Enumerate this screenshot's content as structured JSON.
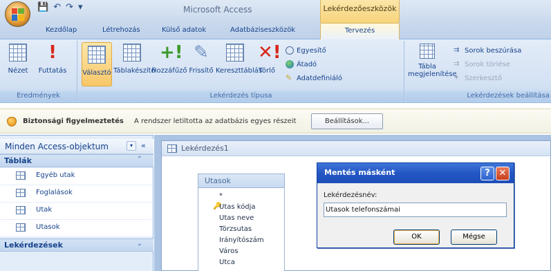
{
  "window": {
    "app_title": "Microsoft Access",
    "context_tab_title": "Lekérdezőeszközök",
    "qat": {
      "save_glyph": "💾",
      "undo_glyph": "↶",
      "redo_glyph": "↷",
      "customize_glyph": "▾"
    }
  },
  "tabs": [
    {
      "label": "Kezdőlap"
    },
    {
      "label": "Létrehozás"
    },
    {
      "label": "Külső adatok"
    },
    {
      "label": "Adatbáziseszközök"
    },
    {
      "label": "Tervezés"
    }
  ],
  "ribbon": {
    "groups": {
      "results": "Eredmények",
      "query_type": "Lekérdezés típusa",
      "setup": "Lekérdezések beállítása"
    },
    "buttons": {
      "view": "Nézet",
      "run": "Futtatás",
      "select": "Választó",
      "make_table": "Táblakészítő",
      "append": "Hozzáfűző",
      "update": "Frissítő",
      "crosstab": "Kereszttáblás",
      "delete": "Törlő",
      "union": "Egyesítő",
      "pass_through": "Átadó",
      "data_definition": "Adatdefiniáló",
      "show_table_line1": "Tábla",
      "show_table_line2": "megjelenítése",
      "insert_rows": "Sorok beszúrása",
      "delete_rows": "Sorok törlése",
      "builder": "Szerkesztő"
    }
  },
  "security_bar": {
    "title": "Biztonsági figyelmeztetés",
    "message": "A rendszer letiltotta az adatbázis egyes részeit",
    "options_button": "Beállítások..."
  },
  "nav_pane": {
    "title": "Minden Access-objektum",
    "dropdown_glyph": "▾",
    "collapse_glyph": "«",
    "categories": [
      {
        "label": "Táblák",
        "chevron": "⌃",
        "items": [
          "Egyéb utak",
          "Foglalások",
          "Utak",
          "Utasok"
        ]
      },
      {
        "label": "Lekérdezések",
        "chevron": "⌄",
        "items": []
      }
    ]
  },
  "document": {
    "title": "Lekérdezés1",
    "table": {
      "name": "Utasok",
      "fields": [
        "*",
        "Utas kódja",
        "Utas neve",
        "Törzsutas",
        "Irányítószám",
        "Város",
        "Utca"
      ]
    }
  },
  "dialog": {
    "title": "Mentés másként",
    "help_glyph": "?",
    "close_glyph": "✕",
    "label": "Lekérdezésnév:",
    "input_value": "Utasok telefonszámai",
    "ok": "OK",
    "cancel": "Mégse"
  },
  "colors": {
    "ribbon_text": "#15428b",
    "selected_button": "#f8c768",
    "dialog_title": "#2457c4",
    "close_button": "#c83f1c"
  }
}
